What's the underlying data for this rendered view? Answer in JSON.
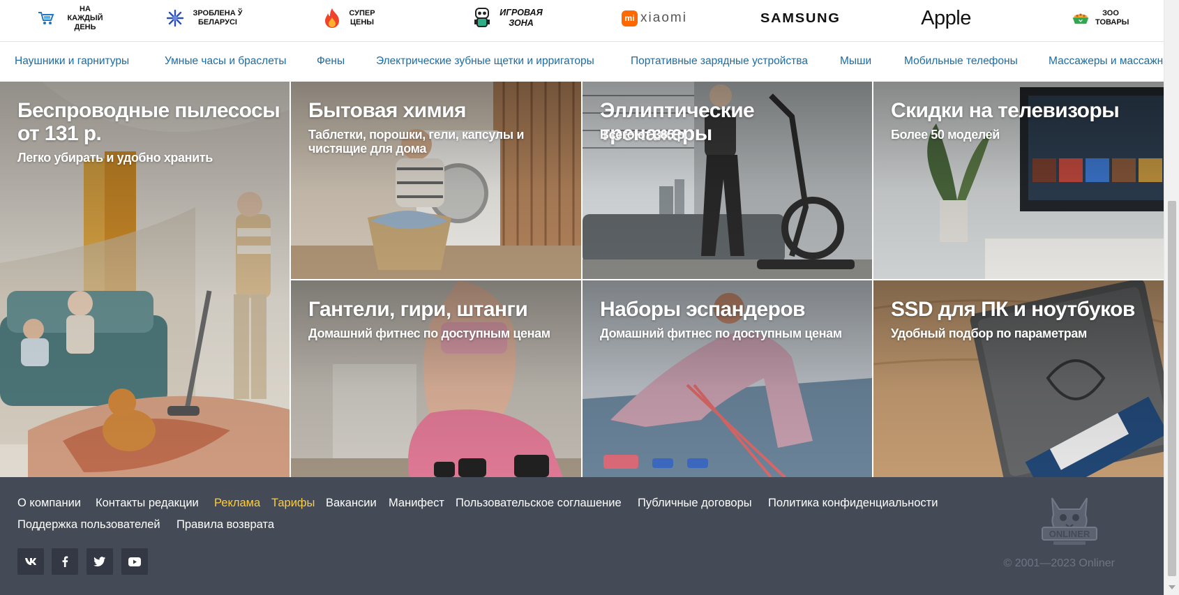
{
  "brand_strip": {
    "items": [
      {
        "label": "На каждый день",
        "icon": "cart-icon"
      },
      {
        "label": "Зроблена ў Беларусі",
        "icon": "cornflower-icon"
      },
      {
        "label": "Супер цены",
        "icon": "flame-icon"
      },
      {
        "label": "Игровая зона",
        "icon": "gamer-mascot-icon"
      },
      {
        "label": "xiaomi",
        "logo_mark": "mi"
      },
      {
        "label": "SAMSUNG"
      },
      {
        "label": "Apple"
      },
      {
        "label": "Зоо товары",
        "icon": "pet-food-bowl-icon"
      }
    ]
  },
  "category_nav": [
    "Наушники и гарнитуры",
    "Умные часы и браслеты",
    "Фены",
    "Электрические зубные щетки и ирригаторы",
    "Портативные зарядные устройства",
    "Мыши",
    "Мобильные телефоны",
    "Массажеры и массажные"
  ],
  "tiles": [
    {
      "title": "Беспроводные пылесосы от 131 р.",
      "subtitle": "Легко убирать и удобно хранить"
    },
    {
      "title": "Бытовая химия",
      "subtitle": "Таблетки, порошки, гели, капсулы и чистящие для дома"
    },
    {
      "title": "Эллиптические тренажеры",
      "subtitle": "Всего от 385 р."
    },
    {
      "title": "Скидки на телевизоры",
      "subtitle": "Более 50 моделей"
    },
    {
      "title": "Гантели, гири, штанги",
      "subtitle": "Домашний фитнес по доступным ценам"
    },
    {
      "title": "Наборы эспандеров",
      "subtitle": "Домашний фитнес по доступным ценам"
    },
    {
      "title": "SSD для ПК и ноутбуков",
      "subtitle": "Удобный подбор по параметрам"
    }
  ],
  "footer": {
    "links": [
      {
        "label": "О компании",
        "accent": false
      },
      {
        "label": "Контакты редакции",
        "accent": false
      },
      {
        "label": "Реклама",
        "accent": true
      },
      {
        "label": "Тарифы",
        "accent": true
      },
      {
        "label": "Вакансии",
        "accent": false
      },
      {
        "label": "Манифест",
        "accent": false
      },
      {
        "label": "Пользовательское соглашение",
        "accent": false
      },
      {
        "label": "Публичные договоры",
        "accent": false
      },
      {
        "label": "Политика конфиденциальности",
        "accent": false
      },
      {
        "label": "Поддержка пользователей",
        "accent": false
      },
      {
        "label": "Правила возврата",
        "accent": false
      }
    ],
    "social": [
      "vk-icon",
      "facebook-icon",
      "twitter-icon",
      "youtube-icon"
    ],
    "copyright": "© 2001—2023 Onliner",
    "logo_text": "ONLINER"
  },
  "colors": {
    "nav_link": "#1a6ca8",
    "footer_bg": "#444a56",
    "footer_accent": "#ffcd38"
  }
}
